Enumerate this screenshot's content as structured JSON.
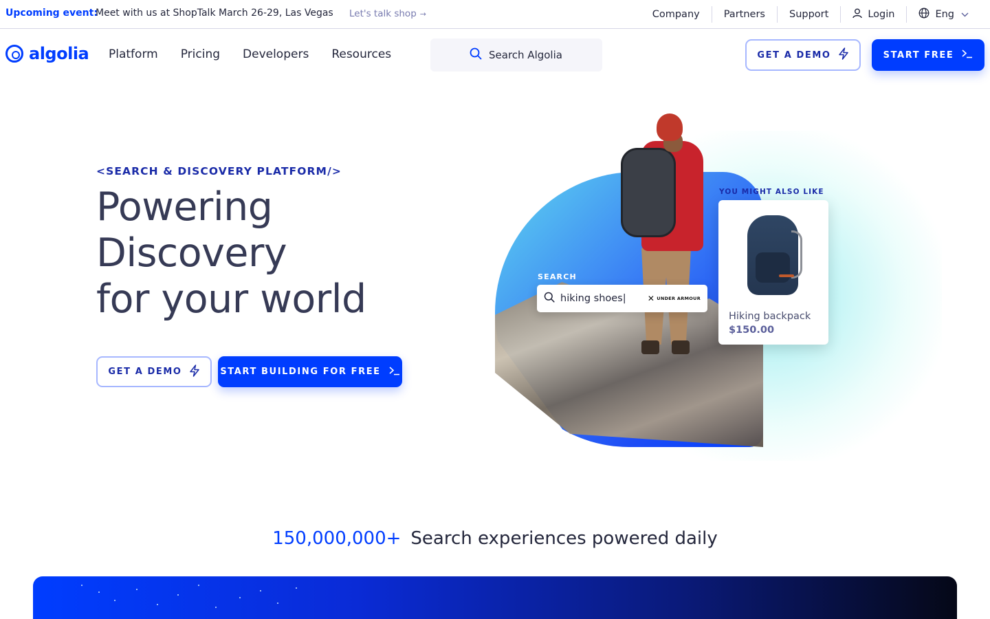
{
  "announcement": {
    "label": "Upcoming event:",
    "text": "Meet with us at ShopTalk March 26-29, Las Vegas",
    "link": "Let's talk shop"
  },
  "util_nav": {
    "company": "Company",
    "partners": "Partners",
    "support": "Support",
    "login": "Login",
    "language": "Eng"
  },
  "main_nav": {
    "logo": "algolia",
    "links": [
      "Platform",
      "Pricing",
      "Developers",
      "Resources"
    ],
    "search_placeholder": "Search Algolia",
    "demo_button": "GET A DEMO",
    "start_button": "START FREE"
  },
  "hero": {
    "eyebrow": "<SEARCH & DISCOVERY PLATFORM/>",
    "headline_line1": "Powering",
    "headline_line2": "Discovery",
    "headline_line3": "for your world",
    "demo_button": "GET A DEMO",
    "start_button": "START BUILDING FOR FREE"
  },
  "visual": {
    "search_label": "SEARCH",
    "search_query": "hiking shoes|",
    "brand": "UNDER ARMOUR",
    "reco_label": "YOU MIGHT ALSO LIKE",
    "product_name": "Hiking backpack",
    "product_price": "$150.00"
  },
  "stats": {
    "number": "150,000,000+",
    "text": "Search experiences powered daily"
  },
  "colors": {
    "brand_blue": "#003dff",
    "text_dark": "#23263b",
    "heading": "#363a55",
    "muted": "#777aaf"
  }
}
